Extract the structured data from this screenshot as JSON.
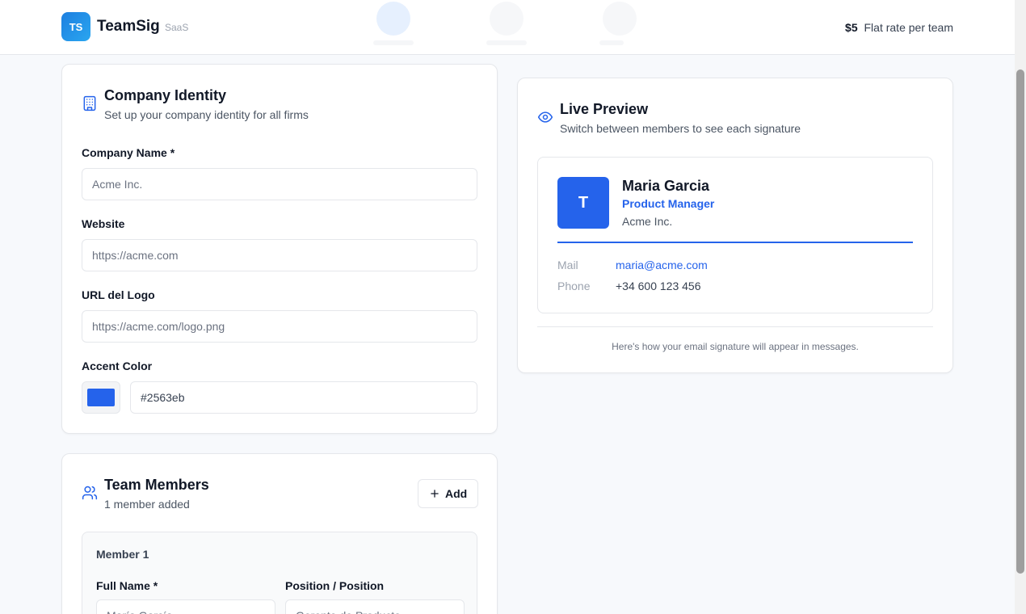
{
  "header": {
    "logo_initials": "TS",
    "brand_name": "TeamSig",
    "brand_tag": "SaaS",
    "price": "$5",
    "price_note": "Flat rate per team"
  },
  "company_identity": {
    "title": "Company Identity",
    "subtitle": "Set up your company identity for all firms",
    "company_name_label": "Company Name *",
    "company_name_placeholder": "Acme Inc.",
    "website_label": "Website",
    "website_placeholder": "https://acme.com",
    "logo_url_label": "URL del Logo",
    "logo_url_placeholder": "https://acme.com/logo.png",
    "accent_label": "Accent Color",
    "accent_value": "#2563eb"
  },
  "team_members": {
    "title": "Team Members",
    "subtitle": "1 member added",
    "add_label": "Add",
    "member_heading": "Member 1",
    "full_name_label": "Full Name *",
    "full_name_placeholder": "María García",
    "position_label": "Position / Position",
    "position_placeholder": "Gerente de Producto"
  },
  "live_preview": {
    "title": "Live Preview",
    "subtitle": "Switch between members to see each signature",
    "avatar_initial": "T",
    "name": "Maria Garcia",
    "role": "Product Manager",
    "company": "Acme Inc.",
    "mail_label": "Mail",
    "mail_value": "maria@acme.com",
    "phone_label": "Phone",
    "phone_value": "+34 600 123 456",
    "note": "Here's how your email signature will appear in messages."
  },
  "colors": {
    "accent": "#2563eb",
    "icon_color": "#2563eb"
  },
  "icons": {
    "company": "building-icon",
    "team": "users-icon",
    "preview": "eye-icon",
    "add": "plus-icon"
  }
}
